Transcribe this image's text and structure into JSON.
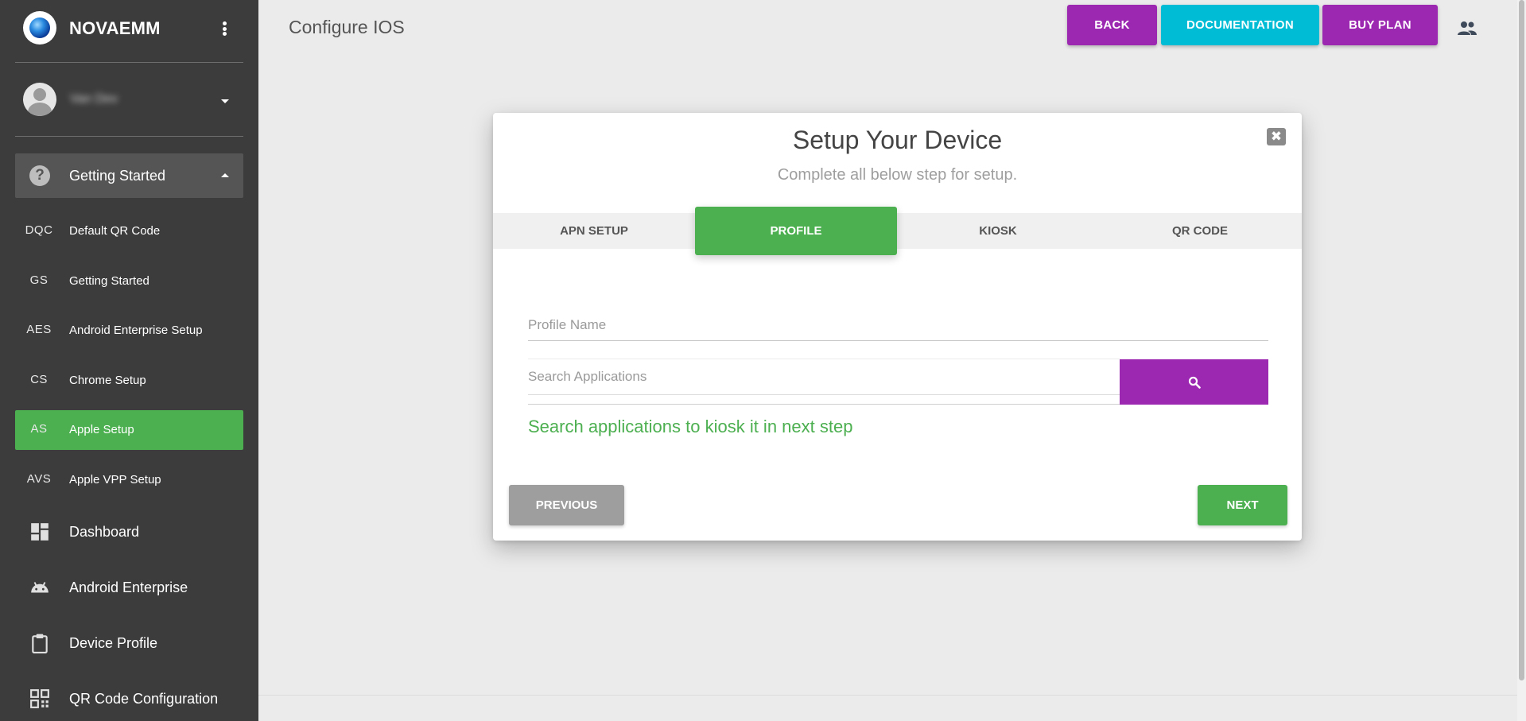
{
  "sidebar": {
    "brand": "NOVAEMM",
    "user": {
      "name": "Van Dev"
    },
    "group": {
      "label": "Getting Started",
      "icon": "help-circle-icon",
      "expanded": true
    },
    "sub_items": [
      {
        "abbr": "DQC",
        "label": "Default QR Code",
        "active": false
      },
      {
        "abbr": "GS",
        "label": "Getting Started",
        "active": false
      },
      {
        "abbr": "AES",
        "label": "Android Enterprise Setup",
        "active": false
      },
      {
        "abbr": "CS",
        "label": "Chrome Setup",
        "active": false
      },
      {
        "abbr": "AS",
        "label": "Apple Setup",
        "active": true
      },
      {
        "abbr": "AVS",
        "label": "Apple VPP Setup",
        "active": false
      }
    ],
    "nav_items": [
      {
        "label": "Dashboard",
        "icon": "dashboard-icon"
      },
      {
        "label": "Android Enterprise",
        "icon": "android-icon"
      },
      {
        "label": "Device Profile",
        "icon": "clipboard-icon"
      },
      {
        "label": "QR Code Configuration",
        "icon": "qr-code-icon"
      }
    ]
  },
  "header": {
    "title": "Configure IOS",
    "back_label": "BACK",
    "docs_label": "DOCUMENTATION",
    "buy_label": "BUY PLAN",
    "user_icon": "people-icon"
  },
  "modal": {
    "title": "Setup Your Device",
    "subtitle": "Complete all below step for setup.",
    "close_icon": "close-icon",
    "tabs": [
      {
        "label": "APN SETUP",
        "active": false
      },
      {
        "label": "PROFILE",
        "active": true
      },
      {
        "label": "KIOSK",
        "active": false
      },
      {
        "label": "QR CODE",
        "active": false
      }
    ],
    "profile_placeholder": "Profile Name",
    "profile_value": "",
    "search_placeholder": "Search Applications",
    "search_value": "",
    "search_icon": "search-icon",
    "hint": "Search applications to kiosk it in next step",
    "previous_label": "PREVIOUS",
    "next_label": "NEXT"
  },
  "colors": {
    "sidebar_bg": "#3c3c3c",
    "accent_green": "#4caf50",
    "accent_purple": "#9c27b0",
    "accent_cyan": "#00bcd4",
    "page_bg": "#ebebeb"
  }
}
